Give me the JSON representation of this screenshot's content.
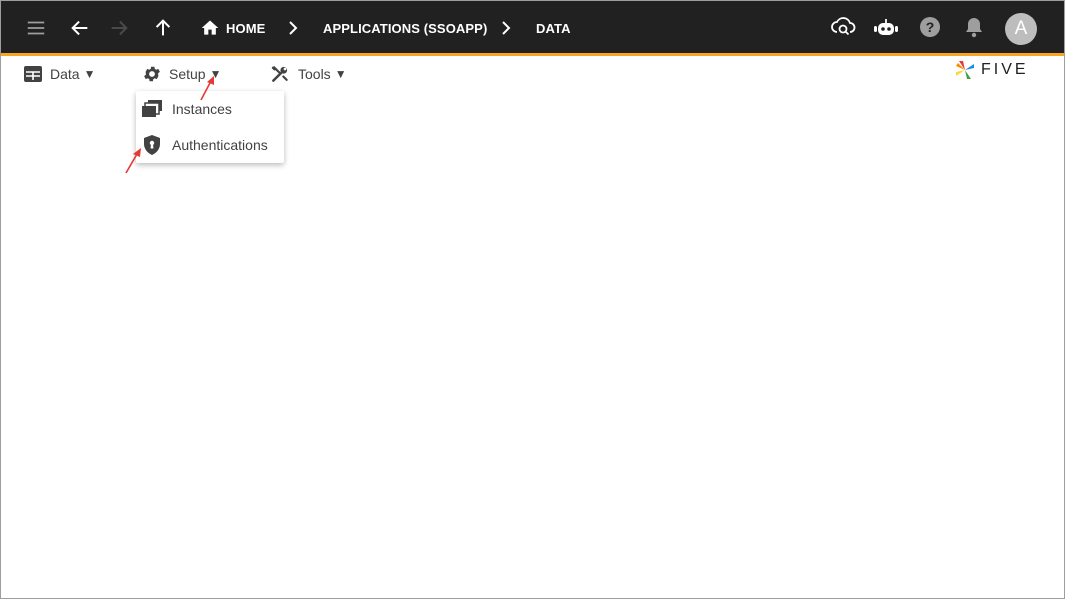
{
  "header": {
    "breadcrumbs": [
      {
        "label": "HOME"
      },
      {
        "label": "APPLICATIONS (SSOAPP)"
      },
      {
        "label": "DATA"
      }
    ],
    "avatar_initial": "A",
    "accent_color": "#f5a623",
    "bar_color": "#212121"
  },
  "menubar": {
    "items": [
      {
        "label": "Data",
        "icon": "table-icon"
      },
      {
        "label": "Setup",
        "icon": "gear-icon"
      },
      {
        "label": "Tools",
        "icon": "wrench-screwdriver-icon"
      }
    ],
    "caret": "▼"
  },
  "setup_menu": {
    "items": [
      {
        "label": "Instances",
        "icon": "instances-icon"
      },
      {
        "label": "Authentications",
        "icon": "shield-icon"
      }
    ]
  },
  "brand": {
    "name": "FIVE"
  }
}
